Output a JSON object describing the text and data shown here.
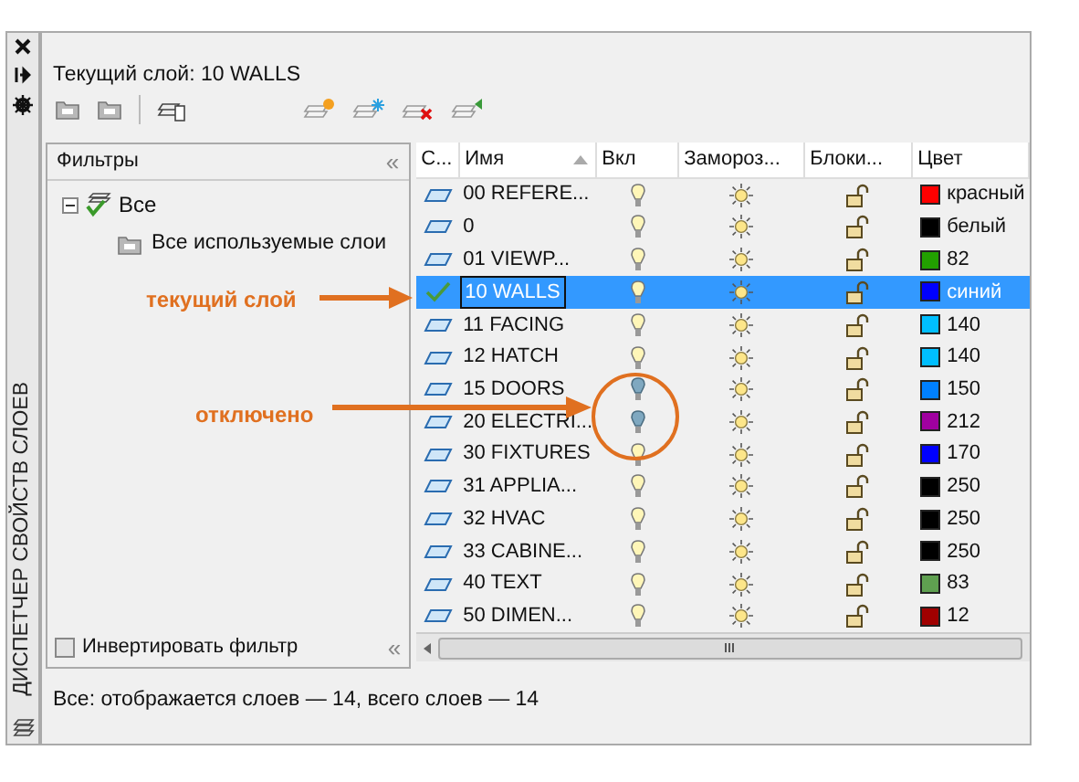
{
  "palette": {
    "title": "ДИСПЕТЧЕР СВОЙСТВ СЛОЕВ"
  },
  "current_layer": {
    "label": "Текущий слой: 10 WALLS"
  },
  "filters": {
    "title": "Фильтры",
    "collapse": "«",
    "tree": [
      {
        "label": "Все",
        "expanded": true,
        "children": [
          {
            "label": "Все используемые слои"
          }
        ]
      }
    ],
    "invert": {
      "label": "Инвертировать фильтр",
      "checked": false
    },
    "bottom_collapse": "«"
  },
  "table": {
    "columns": [
      {
        "label": "С..."
      },
      {
        "label": "Имя",
        "sorted": true
      },
      {
        "label": "Вкл"
      },
      {
        "label": "Замороз..."
      },
      {
        "label": "Блоки..."
      },
      {
        "label": "Цвет"
      }
    ],
    "rows": [
      {
        "name": "00 REFERE...",
        "current": false,
        "selected": false,
        "on": true,
        "frozen": false,
        "locked": false,
        "color": "#ff0000",
        "color_name": "красный"
      },
      {
        "name": "0",
        "current": false,
        "selected": false,
        "on": true,
        "frozen": false,
        "locked": false,
        "color": "#000000",
        "color_name": "белый"
      },
      {
        "name": "01 VIEWP...",
        "current": false,
        "selected": false,
        "on": true,
        "frozen": false,
        "locked": false,
        "color": "#22a000",
        "color_name": "82"
      },
      {
        "name": "10 WALLS",
        "current": true,
        "selected": true,
        "on": true,
        "frozen": false,
        "locked": false,
        "color": "#0000ff",
        "color_name": "синий"
      },
      {
        "name": "11 FACING",
        "current": false,
        "selected": false,
        "on": true,
        "frozen": false,
        "locked": false,
        "color": "#00bfff",
        "color_name": "140"
      },
      {
        "name": "12 HATCH",
        "current": false,
        "selected": false,
        "on": true,
        "frozen": false,
        "locked": false,
        "color": "#00bfff",
        "color_name": "140"
      },
      {
        "name": "15 DOORS",
        "current": false,
        "selected": false,
        "on": false,
        "frozen": false,
        "locked": false,
        "color": "#0080ff",
        "color_name": "150"
      },
      {
        "name": "20 ELECTRI...",
        "current": false,
        "selected": false,
        "on": false,
        "frozen": false,
        "locked": false,
        "color": "#a000a0",
        "color_name": "212"
      },
      {
        "name": "30 FIXTURES",
        "current": false,
        "selected": false,
        "on": true,
        "frozen": false,
        "locked": false,
        "color": "#0000ff",
        "color_name": "170"
      },
      {
        "name": "31 APPLIA...",
        "current": false,
        "selected": false,
        "on": true,
        "frozen": false,
        "locked": false,
        "color": "#000000",
        "color_name": "250"
      },
      {
        "name": "32 HVAC",
        "current": false,
        "selected": false,
        "on": true,
        "frozen": false,
        "locked": false,
        "color": "#000000",
        "color_name": "250"
      },
      {
        "name": "33 CABINE...",
        "current": false,
        "selected": false,
        "on": true,
        "frozen": false,
        "locked": false,
        "color": "#000000",
        "color_name": "250"
      },
      {
        "name": "40 TEXT",
        "current": false,
        "selected": false,
        "on": true,
        "frozen": false,
        "locked": false,
        "color": "#5fa050",
        "color_name": "83"
      },
      {
        "name": "50 DIMEN...",
        "current": false,
        "selected": false,
        "on": true,
        "frozen": false,
        "locked": false,
        "color": "#a00000",
        "color_name": "12"
      }
    ]
  },
  "status_bar": {
    "text": "Все: отображается слоев — 14, всего слоев — 14"
  },
  "annotations": [
    {
      "text": "текущий слой"
    },
    {
      "text": "отключено"
    }
  ]
}
